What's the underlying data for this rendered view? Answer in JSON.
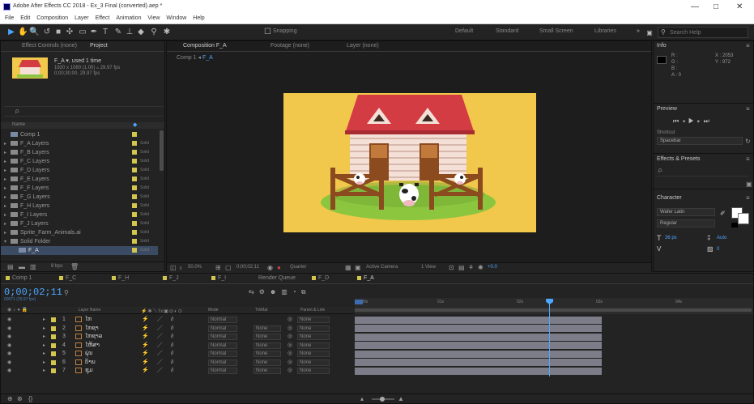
{
  "window": {
    "title": "Adobe After Effects CC 2018 - Ex_3 Final (converted).aep *",
    "controls": [
      "—",
      "□",
      "✕"
    ]
  },
  "menu": [
    "File",
    "Edit",
    "Composition",
    "Layer",
    "Effect",
    "Animation",
    "View",
    "Window",
    "Help"
  ],
  "toolbar": {
    "snapping_label": "Snapping",
    "workspaces": [
      "Default",
      "Standard",
      "Small Screen",
      "Libraries"
    ],
    "search_placeholder": "Search Help"
  },
  "project_panel": {
    "tabs": [
      "Effect Controls (none)",
      "Project"
    ],
    "selected_name": "F_A ▾, used 1 time",
    "selected_info_1": "1920 x 1080 (1.00) ▵ 29.97 fps",
    "selected_info_2": "0;00;30;00, 29.97 fps",
    "search_placeholder": "ρ.",
    "column_name": "Name",
    "items": [
      {
        "name": "Comp 1",
        "type": "comp",
        "color": "#d2c64e",
        "ext": ""
      },
      {
        "name": "F_A Layers",
        "type": "folder",
        "color": "#d2c64e",
        "ext": "Solid"
      },
      {
        "name": "F_B Layers",
        "type": "folder",
        "color": "#d2c64e",
        "ext": "Solid"
      },
      {
        "name": "F_C Layers",
        "type": "folder",
        "color": "#d2c64e",
        "ext": "Solid"
      },
      {
        "name": "F_D Layers",
        "type": "folder",
        "color": "#d2c64e",
        "ext": "Solid"
      },
      {
        "name": "F_E Layers",
        "type": "folder",
        "color": "#d2c64e",
        "ext": "Solid"
      },
      {
        "name": "F_F Layers",
        "type": "folder",
        "color": "#d2c64e",
        "ext": "Solid"
      },
      {
        "name": "F_G Layers",
        "type": "folder",
        "color": "#d2c64e",
        "ext": "Solid"
      },
      {
        "name": "F_H Layers",
        "type": "folder",
        "color": "#d2c64e",
        "ext": "Solid"
      },
      {
        "name": "F_I Layers",
        "type": "folder",
        "color": "#d2c64e",
        "ext": "Solid"
      },
      {
        "name": "F_J Layers",
        "type": "folder",
        "color": "#d2c64e",
        "ext": "Solid"
      },
      {
        "name": "Sprite_Farm_Animals.ai",
        "type": "file",
        "color": "#d2c64e",
        "ext": "Solid"
      },
      {
        "name": "Solid Folder",
        "type": "folder-open",
        "color": "#d2c64e",
        "ext": "Solid"
      },
      {
        "name": "F_A",
        "type": "comp",
        "color": "#d2c64e",
        "ext": "Solid",
        "selected": true
      }
    ],
    "bpc": "8 bpc"
  },
  "composition_panel": {
    "tabs": [
      "Composition F_A",
      "Footage (none)",
      "Layer (none)"
    ],
    "breadcrumb": [
      "Comp 1",
      "F_A"
    ],
    "zoom": "50.0%",
    "timecode": "0;00;02;11",
    "quality": "Quarter",
    "camera": "Active Camera",
    "views": "1 View",
    "exposure": "+0.0"
  },
  "info_panel": {
    "title": "Info",
    "r": "R :",
    "g": "G :",
    "b": "B :",
    "a": "A : 0",
    "x": "X : 2053",
    "y": "Y : 972"
  },
  "preview_panel": {
    "title": "Preview"
  },
  "shortcut_panel": {
    "label": "Shortcut",
    "value": "Spacebar"
  },
  "effects_panel": {
    "title": "Effects & Presets",
    "search": "ρ."
  },
  "character_panel": {
    "title": "Character",
    "font": "Wafer Latin",
    "style": "Regular",
    "size": "36 px",
    "leading": "Auto",
    "tracking": "0"
  },
  "timeline": {
    "tabs": [
      "Comp 1",
      "F_C",
      "F_H",
      "F_J",
      "F_I",
      "Render Queue",
      "F_D",
      "F_A"
    ],
    "active_tab": "F_A",
    "timecode": "0;00;02;11",
    "frames": "00071 (29.97 fps)",
    "columns": {
      "source": "Layer Name",
      "mode": "Mode",
      "trkmat": "TrkMat",
      "parent": "Parent & Link"
    },
    "ruler": [
      "0:00s",
      "01s",
      "02s",
      "03s",
      "04s"
    ],
    "layers": [
      {
        "num": "1",
        "name": "ໄກ",
        "mode": "Normal",
        "trkmat": "",
        "parent": "None",
        "color": "#d2c64e"
      },
      {
        "num": "2",
        "name": "ໄກຊາ",
        "mode": "Normal",
        "trkmat": "None",
        "parent": "None",
        "color": "#d2c64e"
      },
      {
        "num": "3",
        "name": "ໄກຊາລ",
        "mode": "Normal",
        "trkmat": "None",
        "parent": "None",
        "color": "#d2c64e"
      },
      {
        "num": "4",
        "name": "ໄຫ້ສາ",
        "mode": "Normal",
        "trkmat": "None",
        "parent": "None",
        "color": "#d2c64e"
      },
      {
        "num": "5",
        "name": "ພຸ່ນ",
        "mode": "Normal",
        "trkmat": "None",
        "parent": "None",
        "color": "#d2c64e"
      },
      {
        "num": "6",
        "name": "ບ້ານ",
        "mode": "Normal",
        "trkmat": "None",
        "parent": "None",
        "color": "#d2c64e"
      },
      {
        "num": "7",
        "name": "ຊຸມ",
        "mode": "Normal",
        "trkmat": "None",
        "parent": "None",
        "color": "#d2c64e"
      }
    ],
    "playhead_fraction": 0.49
  },
  "colors": {
    "accent": "#2d8ceb",
    "comp_bg": "#f1c84b",
    "roof": "#d43c44",
    "wall": "#f4e0d6",
    "wood": "#8b4b1e",
    "grass": "#8cc63f"
  }
}
